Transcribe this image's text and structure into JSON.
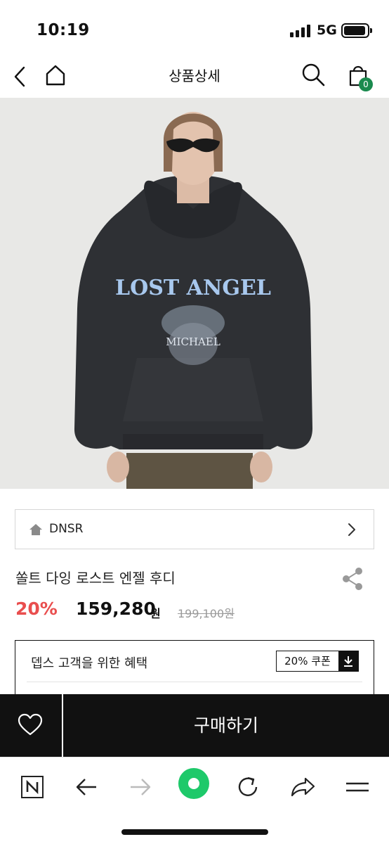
{
  "status_bar": {
    "time": "10:19",
    "network": "5G"
  },
  "header": {
    "title": "상품상세",
    "cart_count": "0"
  },
  "brand": {
    "name": "DNSR"
  },
  "product": {
    "name": "쏠트 다잉 로스트 엔젤 후디",
    "discount": "20%",
    "sale_price": "159,280",
    "currency": "원",
    "original_price": "199,100원"
  },
  "benefit": {
    "label": "뎁스 고객을 위한 혜택",
    "coupon_label": "20% 쿠폰"
  },
  "buy_bar": {
    "buy_label": "구매하기"
  },
  "colors": {
    "accent_green": "#1a8a4e",
    "discount_red": "#e94e4e",
    "bar_black": "#111111"
  }
}
